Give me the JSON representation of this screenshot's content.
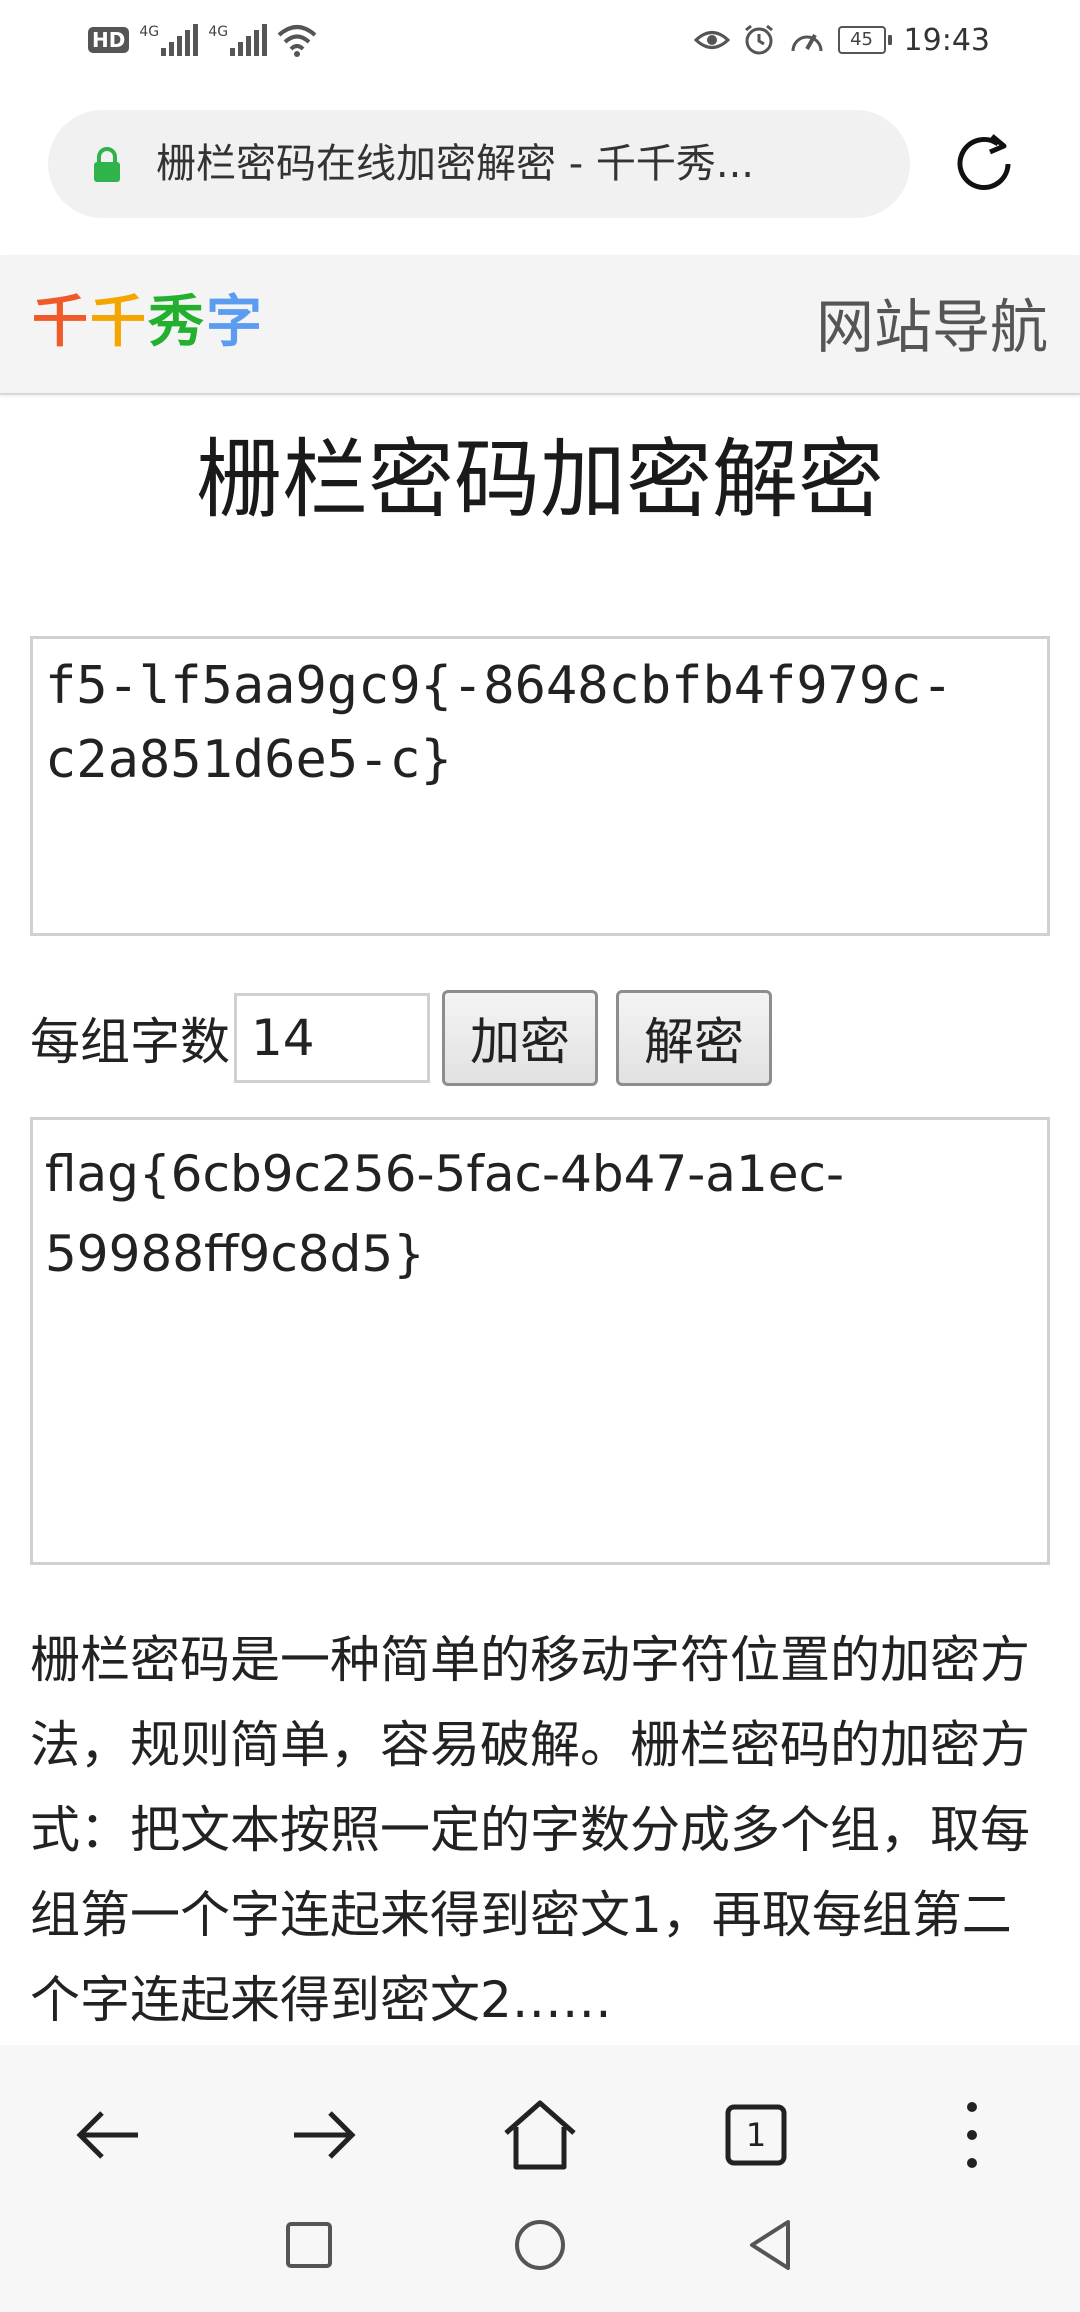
{
  "status_bar": {
    "hd_label": "HD",
    "signal_tag_1": "4G",
    "signal_tag_2": "4G",
    "battery": "45",
    "time": "19:43"
  },
  "browser": {
    "url_title": "栅栏密码在线加密解密 - 千千秀...",
    "icons": [
      "lock-icon",
      "reload-icon",
      "back-arrow-icon",
      "forward-arrow-icon",
      "home-icon",
      "tabs-icon",
      "more-vert-icon"
    ],
    "tab_count": "1"
  },
  "site": {
    "logo": [
      "千",
      "千",
      "秀",
      "字"
    ],
    "logo_colors": [
      "#f05a28",
      "#f4a500",
      "#22b02e",
      "#5b9bf0"
    ],
    "nav_label": "网站导航"
  },
  "page": {
    "title": "栅栏密码加密解密",
    "cipher_text": "f5-lf5aa9gc9{-8648cbfb4f979c-c2a851d6e5-c}",
    "group_label": "每组字数",
    "group_value": "14",
    "encrypt_label": "加密",
    "decrypt_label": "解密",
    "plain_text": "flag{6cb9c256-5fac-4b47-a1ec-59988ff9c8d5}",
    "description": "栅栏密码是一种简单的移动字符位置的加密方法，规则简单，容易破解。栅栏密码的加密方式：把文本按照一定的字数分成多个组，取每组第一个字连起来得到密文1，再取每组第二个字连起来得到密文2……"
  },
  "system_nav": {
    "icons": [
      "recents-square-icon",
      "home-circle-icon",
      "back-triangle-icon"
    ]
  }
}
